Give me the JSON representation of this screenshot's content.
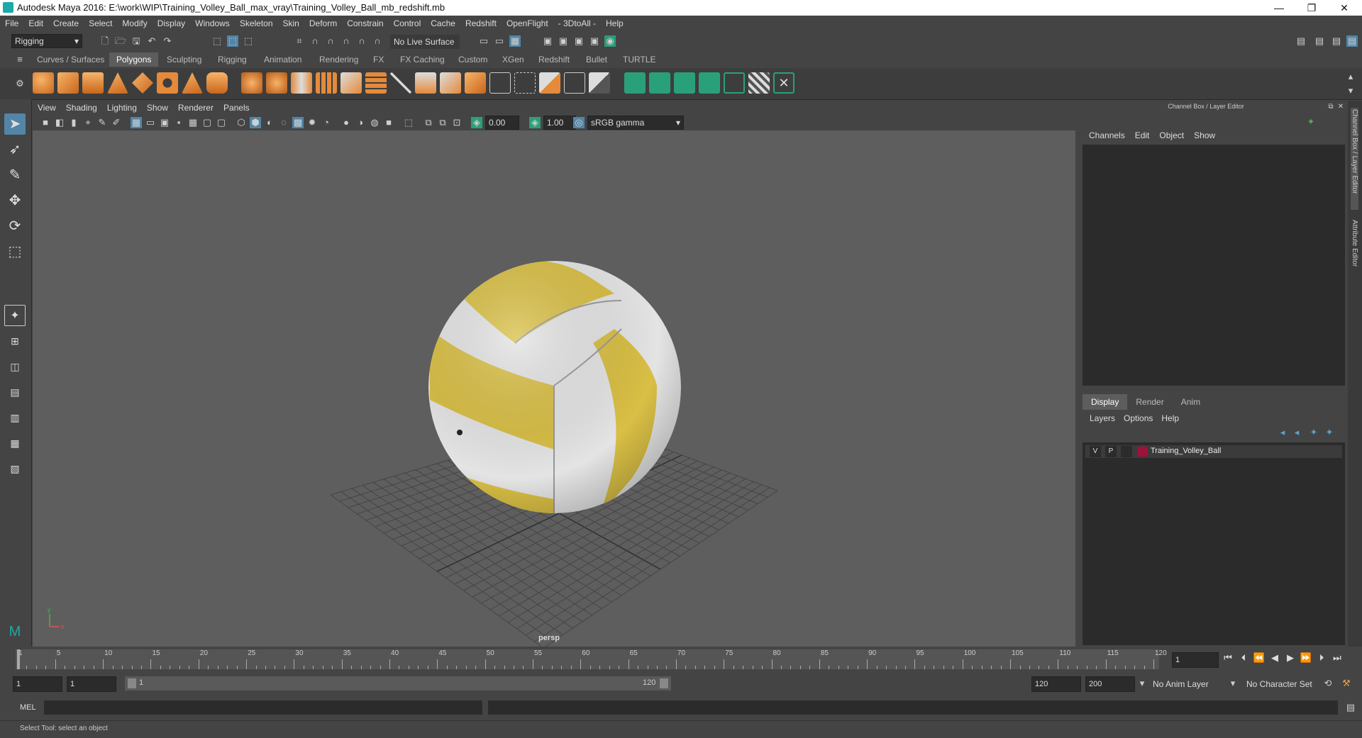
{
  "window": {
    "title": "Autodesk Maya 2016: E:\\work\\WIP\\Training_Volley_Ball_max_vray\\Training_Volley_Ball_mb_redshift.mb"
  },
  "menubar": [
    "File",
    "Edit",
    "Create",
    "Select",
    "Modify",
    "Display",
    "Windows",
    "Skeleton",
    "Skin",
    "Deform",
    "Constrain",
    "Control",
    "Cache",
    "Redshift",
    "OpenFlight",
    "- 3DtoAll -",
    "Help"
  ],
  "statusline": {
    "mode": "Rigging",
    "live_surface": "No Live Surface"
  },
  "shelf_tabs": [
    "Curves / Surfaces",
    "Polygons",
    "Sculpting",
    "Rigging",
    "Animation",
    "Rendering",
    "FX",
    "FX Caching",
    "Custom",
    "XGen",
    "Redshift",
    "Bullet",
    "TURTLE"
  ],
  "shelf_active": "Polygons",
  "panel_menu": [
    "View",
    "Shading",
    "Lighting",
    "Show",
    "Renderer",
    "Panels"
  ],
  "viewport_toolbar": {
    "exposure": "0.00",
    "gamma": "1.00",
    "color_space": "sRGB gamma"
  },
  "viewport": {
    "camera_label": "persp",
    "axis_y": "y",
    "axis_x": "x",
    "colors": {
      "yellow": "#d9bf45",
      "white": "#e4e4e4",
      "grid": "#3f3f3f",
      "bg": "#5e5e5e"
    }
  },
  "channel_box": {
    "title": "Channel Box / Layer Editor",
    "menu": [
      "Channels",
      "Edit",
      "Object",
      "Show"
    ]
  },
  "side_tabs": [
    "Channel Box / Layer Editor",
    "Attribute Editor"
  ],
  "layer_editor": {
    "tabs": [
      "Display",
      "Render",
      "Anim"
    ],
    "active_tab": "Display",
    "menu": [
      "Layers",
      "Options",
      "Help"
    ],
    "layers": [
      {
        "v": "V",
        "p": "P",
        "name": "Training_Volley_Ball",
        "color": "#a0113a"
      }
    ]
  },
  "timeline": {
    "ticks": [
      "1",
      "5",
      "10",
      "15",
      "20",
      "25",
      "30",
      "35",
      "40",
      "45",
      "50",
      "55",
      "60",
      "65",
      "70",
      "75",
      "80",
      "85",
      "90",
      "95",
      "100",
      "105",
      "110",
      "115",
      "120"
    ],
    "current_frame": "1"
  },
  "range": {
    "start": "1",
    "playback_start": "1",
    "slider_start": "1",
    "slider_end": "120",
    "playback_end": "120",
    "end": "200",
    "anim_layer": "No Anim Layer",
    "character_set": "No Character Set"
  },
  "command_line": {
    "label": "MEL"
  },
  "help_line": "Select Tool: select an object"
}
